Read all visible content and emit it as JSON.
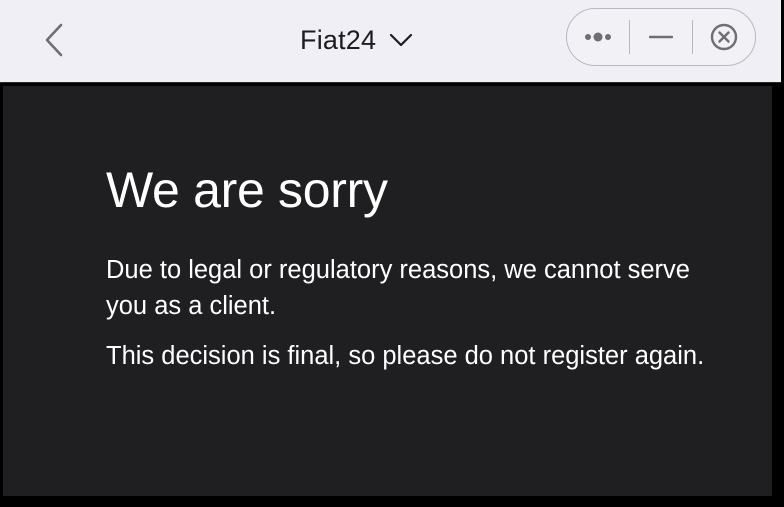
{
  "navbar": {
    "back_icon": "chevron-left-icon",
    "title": "Fiat24",
    "title_dropdown_icon": "chevron-down-icon",
    "capsule": {
      "more_icon": "more-dots-icon",
      "minimize_icon": "minimize-icon",
      "close_icon": "close-circle-icon"
    }
  },
  "main": {
    "heading": "We are sorry",
    "paragraphs": [
      "Due to legal or regulatory reasons, we cannot serve you as a client.",
      "This decision is final, so please do not register again."
    ]
  },
  "colors": {
    "navbar_bg": "#f0eff5",
    "content_bg": "#1f1f21",
    "text_light": "#ffffff",
    "text_dark": "#1d1d1f",
    "icon_gray": "#6e6e73"
  }
}
